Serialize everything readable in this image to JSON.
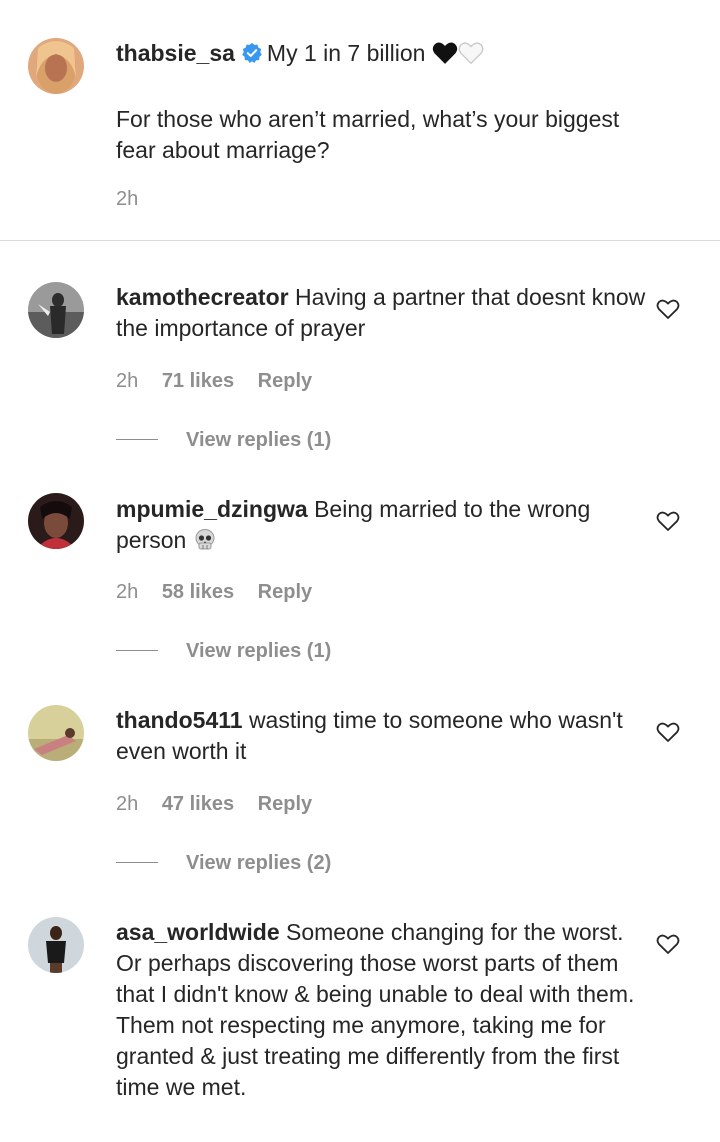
{
  "caption": {
    "username": "thabsie_sa",
    "bio": "My 1 in 7 billion",
    "text": "For those who aren’t married, what’s your biggest fear about marriage?",
    "time": "2h"
  },
  "comments": [
    {
      "username": "kamothecreator",
      "text": "Having a partner that doesnt know the importance of prayer",
      "time": "2h",
      "likes": "71 likes",
      "reply_label": "Reply",
      "view_replies": "View replies (1)"
    },
    {
      "username": "mpumie_dzingwa",
      "text": "Being married to the wrong person",
      "emoji": "skull",
      "time": "2h",
      "likes": "58 likes",
      "reply_label": "Reply",
      "view_replies": "View replies (1)"
    },
    {
      "username": "thando5411",
      "text": "wasting time to someone who wasn't even worth it",
      "time": "2h",
      "likes": "47 likes",
      "reply_label": "Reply",
      "view_replies": "View replies (2)"
    },
    {
      "username": "asa_worldwide",
      "text": "Someone changing for the worst. Or perhaps discovering those worst parts of them that I didn't know & being unable to deal with them. Them not respecting me anymore, taking me for granted & just treating me differently from the first time we met."
    }
  ],
  "icons": {
    "verified": "verified-badge-icon",
    "heart": "heart-outline-icon",
    "emoji_hearts": [
      "black-heart",
      "white-heart"
    ],
    "emoji_skull": "skull"
  },
  "colors": {
    "text": "#262626",
    "secondary": "#8e8e8e",
    "verified_blue": "#3897f0",
    "divider": "#dbdbdb"
  }
}
